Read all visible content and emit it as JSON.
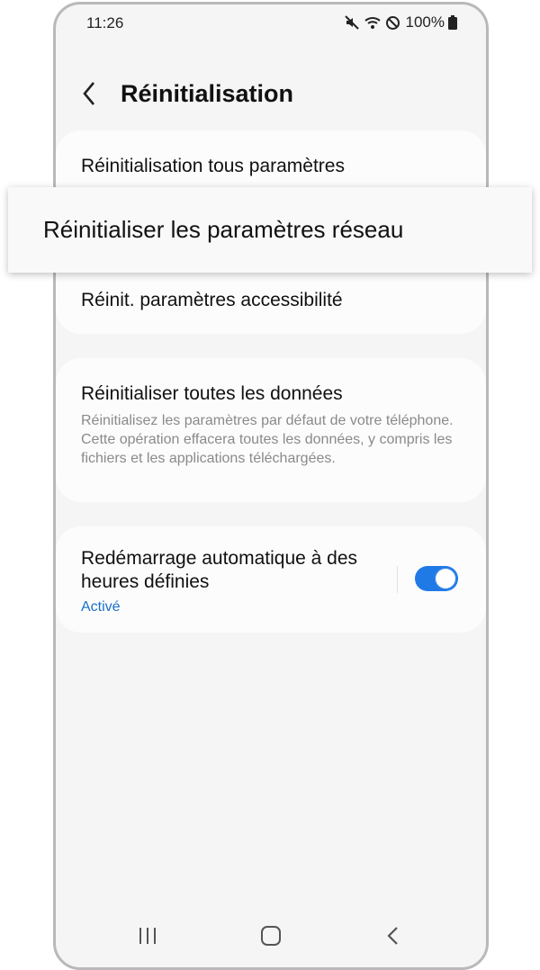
{
  "status_bar": {
    "time": "11:26",
    "battery": "100%",
    "icons": [
      "mute-icon",
      "wifi-icon",
      "do-not-disturb-icon",
      "battery-icon"
    ]
  },
  "header": {
    "title": "Réinitialisation",
    "back_icon": "back-arrow-icon"
  },
  "reset_group": {
    "items": [
      {
        "label": "Réinitialisation tous paramètres"
      },
      {
        "label": "Réinitialiser les paramètres réseau"
      },
      {
        "label": "Réinit. paramètres accessibilité"
      }
    ]
  },
  "factory_reset": {
    "title": "Réinitialiser toutes les données",
    "description": "Réinitialisez les paramètres par défaut de votre téléphone. Cette opération effacera toutes les données, y compris les fichiers et les applications téléchargées."
  },
  "auto_restart": {
    "title": "Redémarrage automatique à des heures définies",
    "status": "Activé",
    "toggle_on": true
  },
  "nav_bar": {
    "buttons": [
      "recent-apps-icon",
      "home-icon",
      "back-icon"
    ]
  },
  "colors": {
    "accent": "#1f7ae6",
    "status_link": "#1a6fc9",
    "background": "#f5f5f5",
    "card": "#fcfcfc"
  }
}
